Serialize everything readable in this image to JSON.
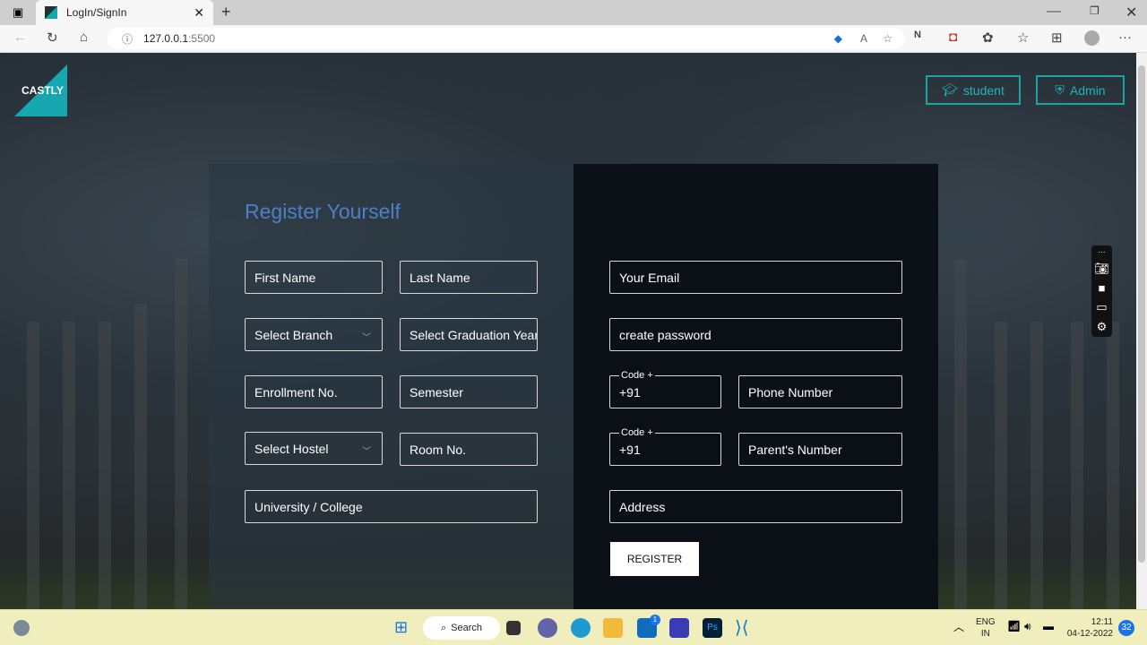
{
  "browser": {
    "tab_title": "LogIn/SignIn",
    "url_host": "127.0.0.1",
    "url_port": ":5500"
  },
  "header": {
    "logo_text": "CASTLY",
    "student_label": "student",
    "admin_label": "Admin",
    "accent": "#1aa5a5"
  },
  "form": {
    "title": "Register Yourself",
    "left": {
      "first_name": "First Name",
      "last_name": "Last Name",
      "branch": "Select Branch",
      "grad_year": "Select Graduation Year",
      "enrollment": "Enrollment No.",
      "semester": "Semester",
      "hostel": "Select Hostel",
      "room": "Room No.",
      "university": "University / College"
    },
    "right": {
      "email": "Your Email",
      "password": "create password",
      "code_label": "Code +",
      "phone_code": "+91",
      "phone": "Phone Number",
      "parent_code": "+91",
      "parent_phone": "Parent's Number",
      "address": "Address",
      "register": "REGISTER"
    }
  },
  "taskbar": {
    "search": "Search",
    "lang1": "ENG",
    "lang2": "IN",
    "time": "12:11",
    "date": "04-12-2022",
    "badge": "32",
    "mail_badge": "1"
  }
}
